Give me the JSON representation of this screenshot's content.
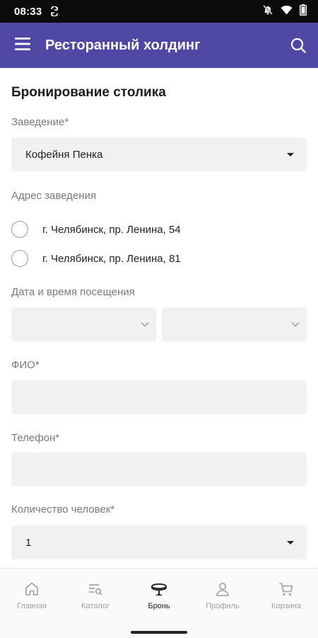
{
  "status_bar": {
    "time": "08:33"
  },
  "app_bar": {
    "title": "Ресторанный холдинг"
  },
  "form": {
    "title": "Бронирование столика",
    "venue": {
      "label": "Заведение*",
      "value": "Кофейня Пенка"
    },
    "address": {
      "label": "Адрес заведения",
      "options": [
        "г. Челябинск, пр. Ленина, 54",
        "г. Челябинск, пр. Ленина, 81"
      ]
    },
    "datetime": {
      "label": "Дата и время посещения",
      "date_value": "",
      "time_value": ""
    },
    "fio": {
      "label": "ФИО*",
      "value": ""
    },
    "phone": {
      "label": "Телефон*",
      "value": ""
    },
    "guests": {
      "label": "Количество человек*",
      "value": "1"
    }
  },
  "bottom_nav": {
    "items": [
      {
        "label": "Главная",
        "icon": "home-icon",
        "active": false
      },
      {
        "label": "Каталог",
        "icon": "catalog-icon",
        "active": false
      },
      {
        "label": "Бронь",
        "icon": "booking-icon",
        "active": true
      },
      {
        "label": "Профиль",
        "icon": "profile-icon",
        "active": false
      },
      {
        "label": "Корзина",
        "icon": "cart-icon",
        "active": false
      }
    ]
  },
  "colors": {
    "accent": "#4f47a4",
    "field_bg": "#f1f1f1",
    "label": "#7a7a7a"
  }
}
